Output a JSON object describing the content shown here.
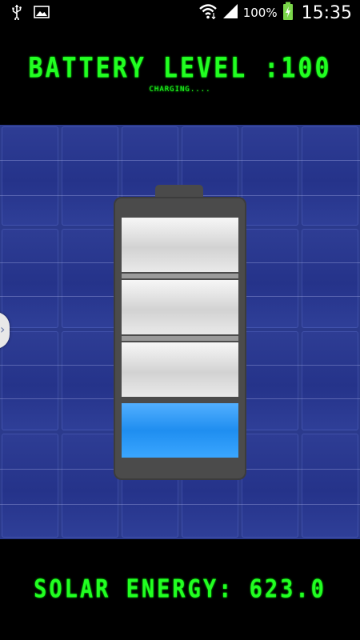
{
  "status_bar": {
    "battery_percent": "100%",
    "time": "15:35",
    "icons": [
      "usb-icon",
      "image-icon",
      "wifi-icon",
      "signal-icon",
      "battery-charging-icon"
    ]
  },
  "header": {
    "title": "BATTERY LEVEL :100",
    "status": "CHARGING...."
  },
  "battery": {
    "level": 100,
    "segments": 4
  },
  "footer": {
    "energy": "SOLAR ENERGY: 623.0"
  },
  "colors": {
    "lcd_green": "#22ff22",
    "panel_blue": "#2b3a8c",
    "charge_blue": "#2f98f5"
  }
}
